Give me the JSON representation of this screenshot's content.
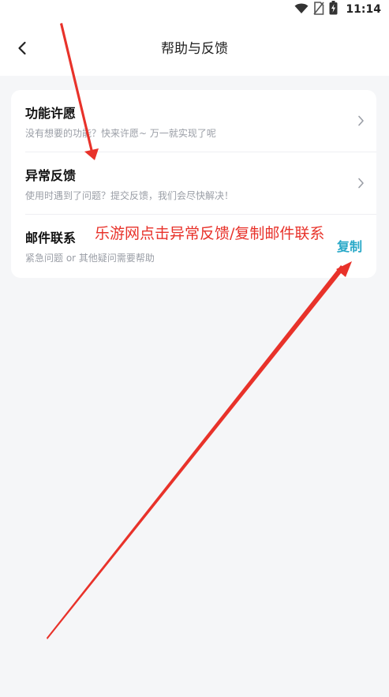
{
  "status_bar": {
    "time": "11:14",
    "icons": [
      "wifi-icon",
      "no-sim-icon",
      "battery-charging-icon"
    ]
  },
  "header": {
    "title": "帮助与反馈",
    "back_icon": "back-arrow-icon"
  },
  "menu": {
    "items": [
      {
        "title": "功能许愿",
        "description": "没有想要的功能？快来许愿~ 万一就实现了呢",
        "trailing": "chevron-right-icon"
      },
      {
        "title": "异常反馈",
        "description": "使用时遇到了问题？提交反馈，我们会尽快解决！",
        "trailing": "chevron-right-icon"
      },
      {
        "title": "邮件联系",
        "description": "紧急问题 or 其他疑问需要帮助",
        "action_label": "复制"
      }
    ]
  },
  "annotation": {
    "text": "乐游网点击异常反馈/复制邮件联系",
    "color": "#e8322a"
  },
  "colors": {
    "accent": "#2aa9c8",
    "page_background": "#f5f6f8",
    "card_background": "#ffffff",
    "annotation": "#e8322a"
  }
}
